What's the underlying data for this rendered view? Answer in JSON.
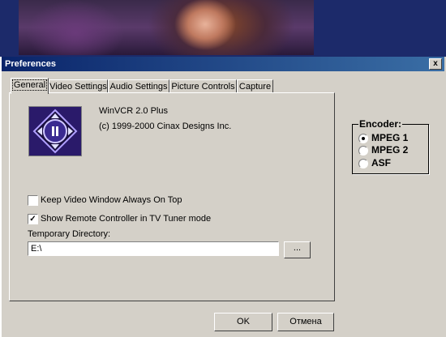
{
  "dialog": {
    "title": "Preferences",
    "close_glyph": "x"
  },
  "tabs": [
    {
      "label": "General",
      "active": true
    },
    {
      "label": "Video Settings",
      "active": false
    },
    {
      "label": "Audio Settings",
      "active": false
    },
    {
      "label": "Picture Controls",
      "active": false
    },
    {
      "label": "Capture",
      "active": false
    }
  ],
  "general": {
    "product_name": "WinVCR 2.0 Plus",
    "copyright": "(c) 1999-2000 Cinax Designs Inc.",
    "keep_on_top": {
      "label": "Keep Video Window Always On Top",
      "checked": false
    },
    "show_remote": {
      "label": "Show Remote Controller in TV Tuner mode",
      "checked": true,
      "check_glyph": "✓"
    },
    "temp_dir": {
      "label": "Temporary Directory:",
      "value": "E:\\"
    },
    "browse_label": "..."
  },
  "encoder": {
    "title": "Encoder:",
    "options": [
      {
        "label": "MPEG 1",
        "selected": true
      },
      {
        "label": "MPEG 2",
        "selected": false
      },
      {
        "label": "ASF",
        "selected": false
      }
    ]
  },
  "buttons": {
    "ok": "OK",
    "cancel": "Отмена"
  },
  "colors": {
    "title_bar_start": "#0a246a",
    "title_bar_end": "#3a6ea5",
    "face": "#d4d0c8"
  }
}
